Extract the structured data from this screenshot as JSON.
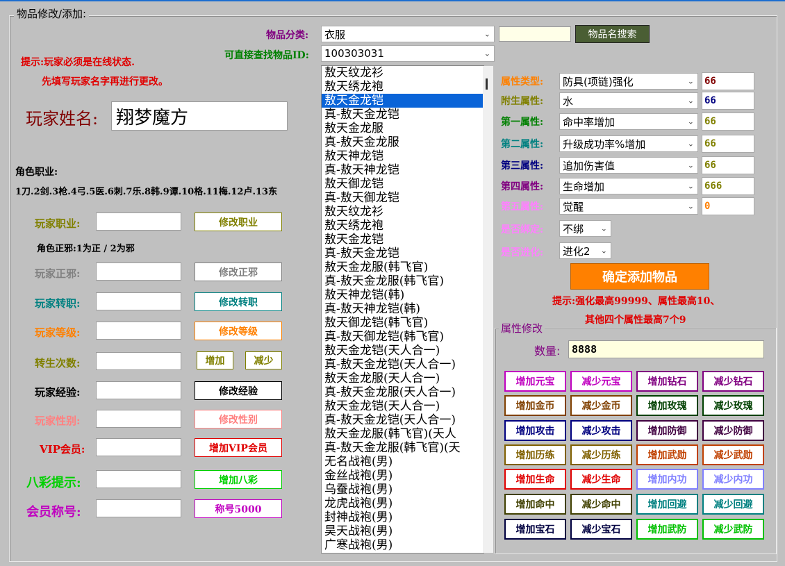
{
  "frame": {
    "title": "物品修改/添加:"
  },
  "item": {
    "category_label": "物品分类:",
    "category_value": "衣服",
    "search_value": "",
    "search_button": "物品名搜索",
    "id_label": "可直接查找物品ID:",
    "id_value": "100303031",
    "list": [
      "敖天纹龙衫",
      "敖天绣龙袍",
      "敖天金龙铠",
      "真-敖天金龙铠",
      "敖天金龙服",
      "真-敖天金龙服",
      "敖天神龙铠",
      "真-敖天神龙铠",
      "敖天御龙铠",
      "真-敖天御龙铠",
      "敖天纹龙衫",
      "敖天绣龙袍",
      "敖天金龙铠",
      "真-敖天金龙铠",
      "敖天金龙服(韩飞官)",
      "真-敖天金龙服(韩飞官)",
      "敖天神龙铠(韩)",
      "真-敖天神龙铠(韩)",
      "敖天御龙铠(韩飞官)",
      "真-敖天御龙铠(韩飞官)",
      "敖天金龙铠(天人合一)",
      "真-敖天金龙铠(天人合一)",
      "敖天金龙服(天人合一)",
      "真-敖天金龙服(天人合一)",
      "敖天金龙铠(天人合一)",
      "真-敖天金龙铠(天人合一)",
      "敖天金龙服(韩飞官)(天人",
      "真-敖天金龙服(韩飞官)(天",
      "无名战袍(男)",
      "金丝战袍(男)",
      "乌蚕战袍(男)",
      "龙虎战袍(男)",
      "封神战袍(男)",
      "昊天战袍(男)",
      "广寒战袍(男)"
    ],
    "selected_index": 2
  },
  "tips": {
    "line1": "提示:玩家必须是在线状态.",
    "line2": "先填写玩家名字再进行更改。"
  },
  "player": {
    "name_label": "玩家姓名:",
    "name_value": "翔梦魔方",
    "job_title": "角色职业:",
    "job_list": "1刀.2剑.3枪.4弓.5医.6刺.7乐.8韩.9谭.10格.11梅.12卢.13东",
    "zx_note": "角色正邪:1为正 / 2为邪"
  },
  "rows": [
    {
      "label": "玩家职业:",
      "value": "",
      "button": "修改职业",
      "color": "#808000"
    },
    {
      "label": "玩家正邪:",
      "value": "",
      "button": "修改正邪",
      "color": "#808080"
    },
    {
      "label": "玩家转职:",
      "value": "",
      "button": "修改转职",
      "color": "#008080"
    },
    {
      "label": "玩家等级:",
      "value": "",
      "button": "修改等级",
      "color": "#ff8000"
    },
    {
      "label": "转生次数:",
      "value": "",
      "button1": "增加",
      "button2": "减少",
      "color": "#808000"
    },
    {
      "label": "玩家经验:",
      "value": "",
      "button": "修改经验",
      "color": "#000000"
    },
    {
      "label": "玩家性别:",
      "value": "",
      "button": "修改性别",
      "color": "#ff8080"
    },
    {
      "label": "VIP会员:",
      "value": "",
      "button": "增加VIP会员",
      "color": "#e00000"
    },
    {
      "label": "八彩提示:",
      "value": "",
      "button": "增加八彩",
      "color": "#00d000"
    },
    {
      "label": "会员称号:",
      "value": "",
      "button": "称号5000",
      "color": "#c000c0"
    }
  ],
  "attrs": [
    {
      "label": "属性类型:",
      "select": "防具(项链)强化",
      "value": "66",
      "label_color": "#ff8000",
      "value_color": "#800000"
    },
    {
      "label": "附生属性:",
      "select": "水",
      "value": "66",
      "label_color": "#808000",
      "value_color": "#000080"
    },
    {
      "label": "第一属性:",
      "select": "命中率增加",
      "value": "66",
      "label_color": "#008000",
      "value_color": "#808000"
    },
    {
      "label": "第二属性:",
      "select": "升级成功率%增加",
      "value": "66",
      "label_color": "#008080",
      "value_color": "#808000"
    },
    {
      "label": "第三属性:",
      "select": "追加伤害值",
      "value": "66",
      "label_color": "#000080",
      "value_color": "#808000"
    },
    {
      "label": "第四属性:",
      "select": "生命增加",
      "value": "666",
      "label_color": "#800080",
      "value_color": "#808000"
    },
    {
      "label": "第五属性:",
      "select": "觉醒",
      "value": "0",
      "label_color": "#ff80ff",
      "value_color": "#ff8000"
    }
  ],
  "bind": {
    "label": "是否绑定:",
    "select": "不绑"
  },
  "evolve": {
    "label": "是否进化:",
    "select": "进化2"
  },
  "confirm_button": "确定添加物品",
  "limits": {
    "line1": "提示:强化最高99999、属性最高10、",
    "line2": "其他四个属性最高7个9"
  },
  "property": {
    "title": "属性修改",
    "qty_label": "数量:",
    "qty_value": "8888",
    "buttons": [
      [
        {
          "t": "增加元宝",
          "c": "#c000c0"
        },
        {
          "t": "减少元宝",
          "c": "#c000c0"
        },
        {
          "t": "增加钻石",
          "c": "#800080"
        },
        {
          "t": "减少钻石",
          "c": "#800080"
        }
      ],
      [
        {
          "t": "增加金币",
          "c": "#804000"
        },
        {
          "t": "减少金币",
          "c": "#804000"
        },
        {
          "t": "增加玫瑰",
          "c": "#004000"
        },
        {
          "t": "减少玫瑰",
          "c": "#004000"
        }
      ],
      [
        {
          "t": "增加攻击",
          "c": "#000080"
        },
        {
          "t": "减少攻击",
          "c": "#000080"
        },
        {
          "t": "增加防御",
          "c": "#400040"
        },
        {
          "t": "减少防御",
          "c": "#400040"
        }
      ],
      [
        {
          "t": "增加历练",
          "c": "#806000"
        },
        {
          "t": "减少历练",
          "c": "#806000"
        },
        {
          "t": "增加武勋",
          "c": "#c04000"
        },
        {
          "t": "减少武勋",
          "c": "#c04000"
        }
      ],
      [
        {
          "t": "增加生命",
          "c": "#e00000"
        },
        {
          "t": "减少生命",
          "c": "#e00000"
        },
        {
          "t": "增加内功",
          "c": "#8080ff"
        },
        {
          "t": "减少内功",
          "c": "#8080ff"
        }
      ],
      [
        {
          "t": "增加命中",
          "c": "#404000"
        },
        {
          "t": "减少命中",
          "c": "#404000"
        },
        {
          "t": "增加回避",
          "c": "#008080"
        },
        {
          "t": "减少回避",
          "c": "#008080"
        }
      ],
      [
        {
          "t": "增加宝石",
          "c": "#000040"
        },
        {
          "t": "减少宝石",
          "c": "#000040"
        },
        {
          "t": "增加武防",
          "c": "#00c000"
        },
        {
          "t": "减少武防",
          "c": "#00c000"
        }
      ]
    ]
  }
}
